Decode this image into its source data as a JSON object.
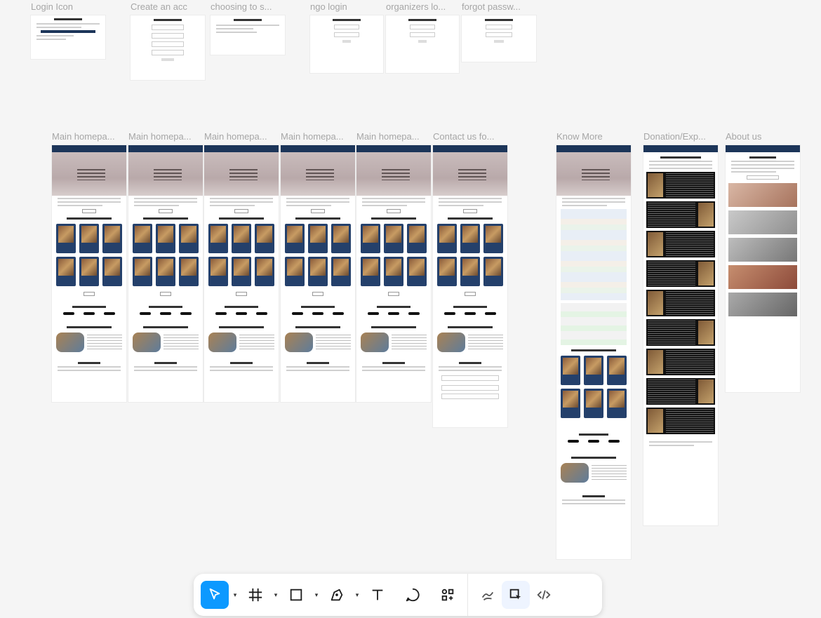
{
  "frames_top": [
    {
      "label": "Login Icon"
    },
    {
      "label": "Create an acc"
    },
    {
      "label": "choosing to s..."
    },
    {
      "label": "ngo login"
    },
    {
      "label": "organizers lo..."
    },
    {
      "label": "forgot passw..."
    }
  ],
  "frames_main": [
    {
      "label": "Main homepa..."
    },
    {
      "label": "Main homepa..."
    },
    {
      "label": "Main homepa..."
    },
    {
      "label": "Main homepa..."
    },
    {
      "label": "Main homepa..."
    },
    {
      "label": "Contact us fo..."
    }
  ],
  "frames_side": [
    {
      "label": "Know More"
    },
    {
      "label": "Donation/Exp..."
    },
    {
      "label": "About us"
    }
  ],
  "toolbar": {
    "tools": [
      "move-tool",
      "frame-tool",
      "rectangle-tool",
      "pen-tool",
      "text-tool",
      "comment-tool",
      "actions-tool"
    ],
    "right_tools": [
      "draw-mode",
      "design-mode",
      "dev-mode"
    ],
    "active": "move-tool",
    "accent": "#0d99ff"
  }
}
